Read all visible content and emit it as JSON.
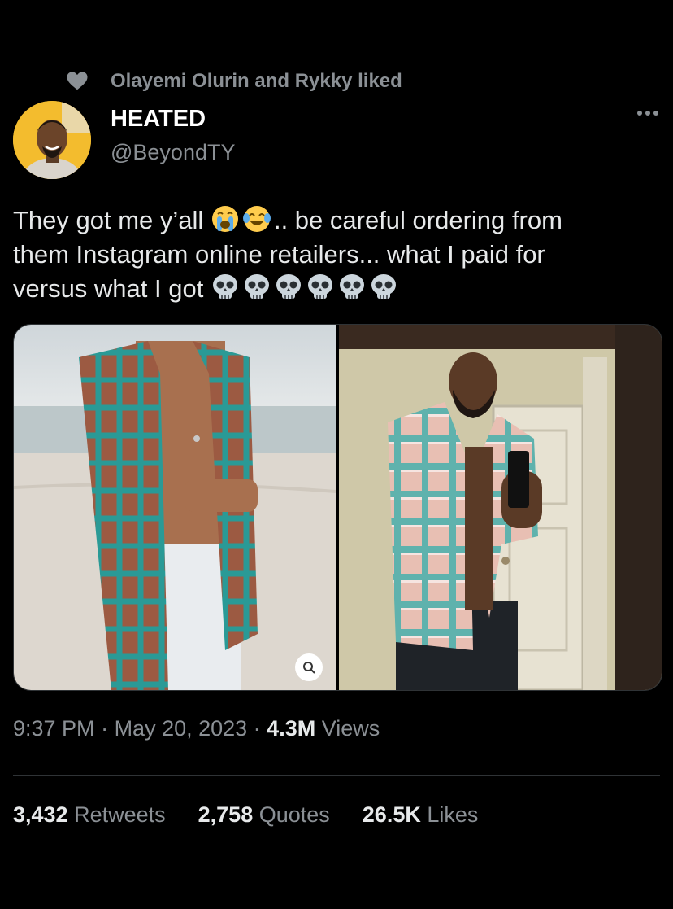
{
  "social_context": {
    "text": "Olayemi Olurin and Rykky liked",
    "icon": "heart-icon"
  },
  "author": {
    "name": "HEATED",
    "handle": "@BeyondTY"
  },
  "tweet": {
    "line1_a": "They got me y’all",
    "line1_b": ".. be careful ordering from",
    "line2": "them Instagram online retailers... what I paid for",
    "line3": "versus what I got",
    "emojis_line1": [
      "crying-face",
      "tears-of-joy-face"
    ],
    "emojis_line3": [
      "skull",
      "skull",
      "skull",
      "skull",
      "skull",
      "skull"
    ]
  },
  "media": {
    "left_alt": "Model on beach wearing teal crochet cardigan",
    "right_alt": "Man in mirror selfie wearing pink and teal checked cardigan"
  },
  "meta": {
    "time": "9:37 PM",
    "sep1": " · ",
    "date": "May 20, 2023",
    "sep2": " · ",
    "views_count": "4.3M",
    "views_label": " Views"
  },
  "stats": {
    "retweets_count": "3,432",
    "retweets_label": " Retweets",
    "quotes_count": "2,758",
    "quotes_label": " Quotes",
    "likes_count": "26.5K",
    "likes_label": " Likes"
  },
  "colors": {
    "background": "#000000",
    "text": "#e7e9ea",
    "muted": "#8b9095",
    "divider": "#2f3336"
  }
}
